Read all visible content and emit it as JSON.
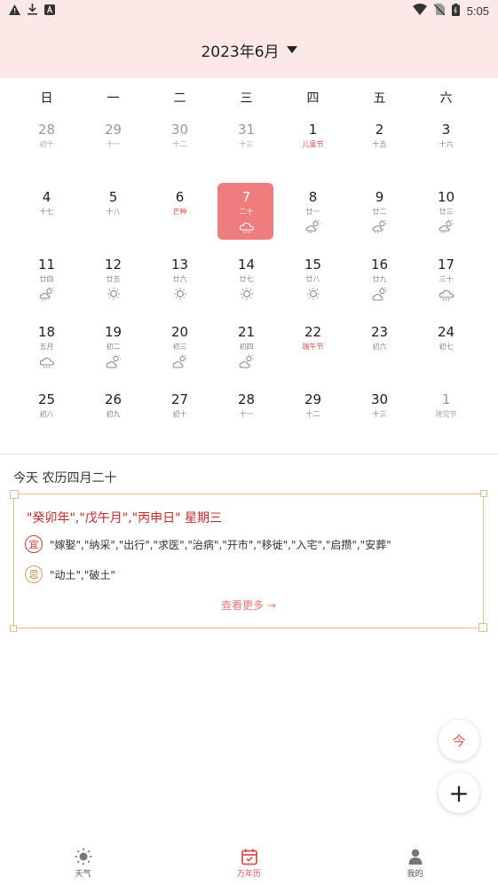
{
  "status_bar": {
    "time": "5:05",
    "left_icons": [
      "warning-icon",
      "download-icon",
      "a-icon"
    ],
    "right_icons": [
      "wifi-icon",
      "no-sim-icon",
      "battery-icon"
    ]
  },
  "header": {
    "month": "2023年6月"
  },
  "weekdays": [
    "日",
    "一",
    "二",
    "三",
    "四",
    "五",
    "六"
  ],
  "days": [
    {
      "d": "28",
      "l": "初十",
      "other": true
    },
    {
      "d": "29",
      "l": "十一",
      "other": true
    },
    {
      "d": "30",
      "l": "十二",
      "other": true
    },
    {
      "d": "31",
      "l": "十三",
      "other": true
    },
    {
      "d": "1",
      "l": "儿童节",
      "red": true
    },
    {
      "d": "2",
      "l": "十五"
    },
    {
      "d": "3",
      "l": "十六"
    },
    {
      "d": "4",
      "l": "十七"
    },
    {
      "d": "5",
      "l": "十八"
    },
    {
      "d": "6",
      "l": "芒种",
      "red": true
    },
    {
      "d": "7",
      "l": "二十",
      "today": true,
      "w": "rain"
    },
    {
      "d": "8",
      "l": "廿一",
      "w": "sun-cloud-rain"
    },
    {
      "d": "9",
      "l": "廿二",
      "w": "sun-cloud-rain"
    },
    {
      "d": "10",
      "l": "廿三",
      "w": "sun-cloud-rain"
    },
    {
      "d": "11",
      "l": "廿四",
      "w": "sun-cloud-rain"
    },
    {
      "d": "12",
      "l": "廿五",
      "w": "sun"
    },
    {
      "d": "13",
      "l": "廿六",
      "w": "sun"
    },
    {
      "d": "14",
      "l": "廿七",
      "w": "sun"
    },
    {
      "d": "15",
      "l": "廿八",
      "w": "sun"
    },
    {
      "d": "16",
      "l": "廿九",
      "w": "sun-cloud"
    },
    {
      "d": "17",
      "l": "三十",
      "w": "rain"
    },
    {
      "d": "18",
      "l": "五月",
      "w": "rain"
    },
    {
      "d": "19",
      "l": "初二",
      "w": "sun-cloud"
    },
    {
      "d": "20",
      "l": "初三",
      "w": "sun-cloud"
    },
    {
      "d": "21",
      "l": "初四",
      "w": "sun-cloud"
    },
    {
      "d": "22",
      "l": "端午节",
      "red": true
    },
    {
      "d": "23",
      "l": "初六"
    },
    {
      "d": "24",
      "l": "初七"
    },
    {
      "d": "25",
      "l": "初八"
    },
    {
      "d": "26",
      "l": "初九"
    },
    {
      "d": "27",
      "l": "初十"
    },
    {
      "d": "28",
      "l": "十一"
    },
    {
      "d": "29",
      "l": "十二"
    },
    {
      "d": "30",
      "l": "十三"
    },
    {
      "d": "1",
      "l": "建党节",
      "other": true
    }
  ],
  "almanac": {
    "today_label": "今天 农历四月二十",
    "ganzhi": "\"癸卯年\",\"戊午月\",\"丙申日\" 星期三",
    "yi_label": "宜",
    "yi_text": "\"嫁娶\",\"纳采\",\"出行\",\"求医\",\"治病\",\"开市\",\"移徙\",\"入宅\",\"启攒\",\"安葬\"",
    "ji_label": "忌",
    "ji_text": "\"动土\",\"破土\"",
    "more_label": "查看更多 →"
  },
  "fab": {
    "today_label": "今",
    "add_label": "+"
  },
  "nav": [
    {
      "label": "天气",
      "icon": "sun-icon"
    },
    {
      "label": "万年历",
      "icon": "calendar-icon",
      "active": true
    },
    {
      "label": "我的",
      "icon": "user-icon"
    }
  ],
  "colors": {
    "accent": "#f07d7d",
    "header_bg": "#fde8e8",
    "festival": "#e05050",
    "border_gold": "#e3c089"
  }
}
